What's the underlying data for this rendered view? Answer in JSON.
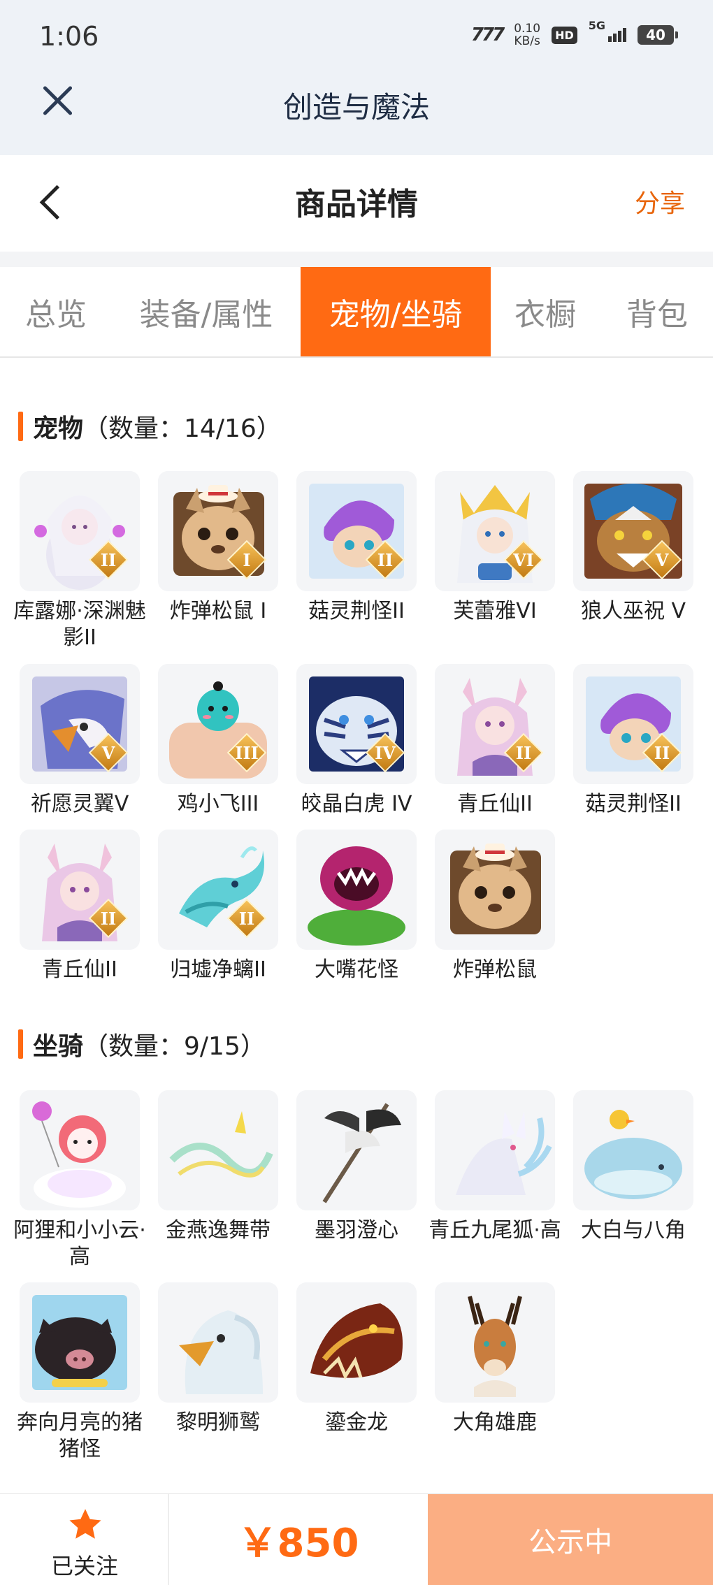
{
  "status_bar": {
    "time": "1:06",
    "signal_logo": "777",
    "net_speed": "0.10",
    "net_unit": "KB/s",
    "hd": "HD",
    "network": "5G",
    "battery": "40"
  },
  "app": {
    "title": "创造与魔法"
  },
  "page": {
    "title": "商品详情",
    "share_label": "分享"
  },
  "tabs": [
    {
      "label": "总览",
      "active": false
    },
    {
      "label": "装备/属性",
      "active": false
    },
    {
      "label": "宠物/坐骑",
      "active": true
    },
    {
      "label": "衣橱",
      "active": false
    },
    {
      "label": "背包",
      "active": false
    }
  ],
  "pets": {
    "title": "宠物",
    "count": "（数量：14/16）",
    "items": [
      {
        "name": "库露娜·深渊魅影II",
        "badge": "II",
        "icon": "fairy-girl-icon"
      },
      {
        "name": "炸弹松鼠 I",
        "badge": "I",
        "icon": "bomb-squirrel-icon"
      },
      {
        "name": "菇灵荆怪II",
        "badge": "II",
        "icon": "mushroom-sprite-icon"
      },
      {
        "name": "芙蕾雅VI",
        "badge": "VI",
        "icon": "valkyrie-girl-icon"
      },
      {
        "name": "狼人巫祝 V",
        "badge": "V",
        "icon": "werewolf-shaman-icon"
      },
      {
        "name": "祈愿灵翼V",
        "badge": "V",
        "icon": "spirit-wing-bird-icon"
      },
      {
        "name": "鸡小飞III",
        "badge": "III",
        "icon": "chick-icon"
      },
      {
        "name": "皎晶白虎 IV",
        "badge": "IV",
        "icon": "white-tiger-icon"
      },
      {
        "name": "青丘仙II",
        "badge": "II",
        "icon": "fox-fairy-icon"
      },
      {
        "name": "菇灵荆怪II",
        "badge": "II",
        "icon": "mushroom-sprite-icon"
      },
      {
        "name": "青丘仙II",
        "badge": "II",
        "icon": "fox-fairy-icon"
      },
      {
        "name": "归墟净螭II",
        "badge": "II",
        "icon": "water-dragon-icon"
      },
      {
        "name": "大嘴花怪",
        "badge": "",
        "icon": "piranha-plant-icon"
      },
      {
        "name": "炸弹松鼠",
        "badge": "",
        "icon": "bomb-squirrel-icon"
      }
    ]
  },
  "mounts": {
    "title": "坐骑",
    "count": "（数量：9/15）",
    "items": [
      {
        "name": "阿狸和小小云·高",
        "icon": "fox-cloud-icon"
      },
      {
        "name": "金燕逸舞带",
        "icon": "ribbon-icon"
      },
      {
        "name": "墨羽澄心",
        "icon": "feather-staff-icon"
      },
      {
        "name": "青丘九尾狐·高",
        "icon": "nine-tail-fox-icon"
      },
      {
        "name": "大白与八角",
        "icon": "whale-icon"
      },
      {
        "name": "奔向月亮的猪猪怪",
        "icon": "pig-icon"
      },
      {
        "name": "黎明狮鹫",
        "icon": "griffin-icon"
      },
      {
        "name": "鎏金龙",
        "icon": "golden-dragon-icon"
      },
      {
        "name": "大角雄鹿",
        "icon": "stag-icon"
      }
    ]
  },
  "bottom": {
    "follow_label": "已关注",
    "follow_icon": "star-icon",
    "price": "￥850",
    "status_label": "公示中"
  },
  "colors": {
    "accent": "#ff6a13",
    "status_button": "#fbae83",
    "header_bg": "#eef2f7"
  }
}
